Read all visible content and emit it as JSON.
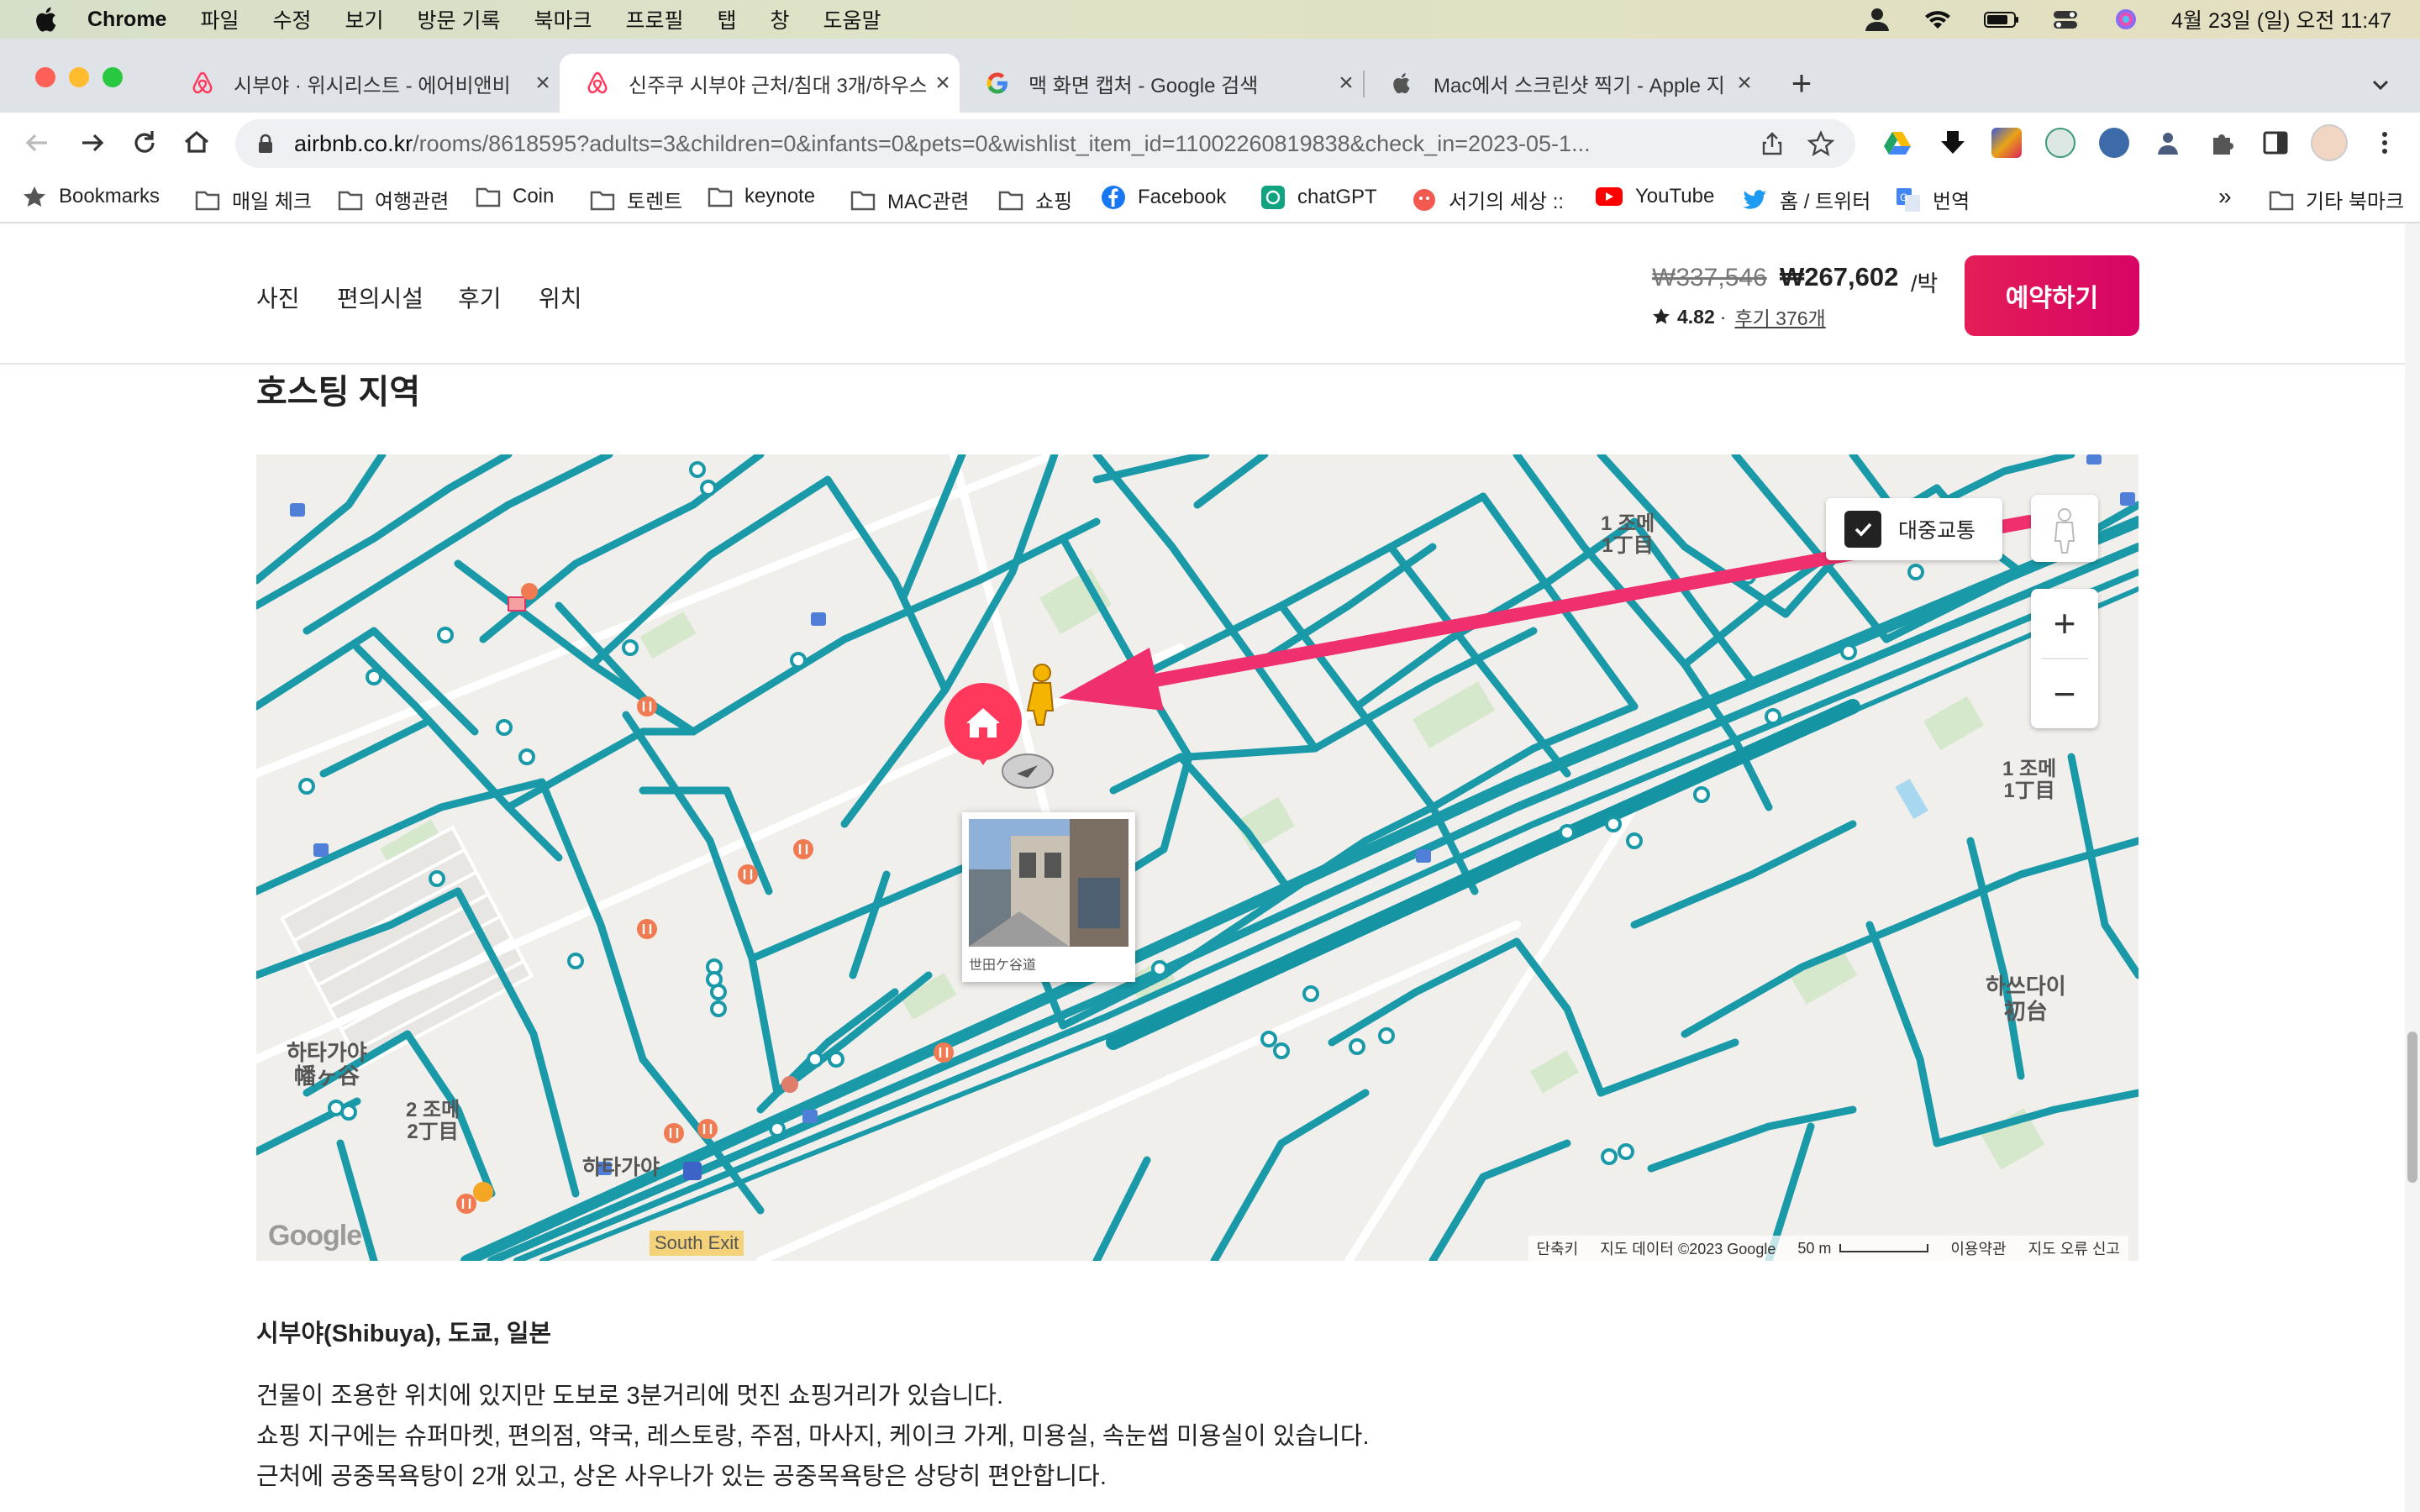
{
  "menubar": {
    "app_name": "Chrome",
    "items": [
      "파일",
      "수정",
      "보기",
      "방문 기록",
      "북마크",
      "프로필",
      "탭",
      "창",
      "도움말"
    ],
    "datetime": "4월 23일 (일) 오전 11:47"
  },
  "tabs": [
    {
      "label": "시부야 · 위시리스트 - 에어비앤비",
      "icon": "airbnb-icon"
    },
    {
      "label": "신주쿠 시부야 근처/침대 3개/하우스",
      "icon": "airbnb-icon",
      "active": true
    },
    {
      "label": "맥 화면 캡처 - Google 검색",
      "icon": "google-icon"
    },
    {
      "label": "Mac에서 스크린샷 찍기 - Apple 지",
      "icon": "apple-icon"
    }
  ],
  "address": {
    "host": "airbnb.co.kr",
    "path": "/rooms/8618595?adults=3&children=0&infants=0&pets=0&wishlist_item_id=11002260819838&check_in=2023-05-1..."
  },
  "bookmarks": {
    "items": [
      {
        "label": "Bookmarks",
        "icon": "star-icon"
      },
      {
        "label": "매일 체크",
        "icon": "folder-icon"
      },
      {
        "label": "여행관련",
        "icon": "folder-icon"
      },
      {
        "label": "Coin",
        "icon": "folder-icon"
      },
      {
        "label": "토렌트",
        "icon": "folder-icon"
      },
      {
        "label": "keynote",
        "icon": "folder-icon"
      },
      {
        "label": "MAC관련",
        "icon": "folder-icon"
      },
      {
        "label": "쇼핑",
        "icon": "folder-icon"
      },
      {
        "label": "Facebook",
        "icon": "facebook-icon"
      },
      {
        "label": "chatGPT",
        "icon": "chatgpt-icon"
      },
      {
        "label": "서기의 세상 ::",
        "icon": "site-icon"
      },
      {
        "label": "YouTube",
        "icon": "youtube-icon"
      },
      {
        "label": "홈 / 트위터",
        "icon": "twitter-icon"
      },
      {
        "label": "번역",
        "icon": "translate-icon"
      }
    ],
    "overflow": "»",
    "other": "기타 북마크"
  },
  "subnav": {
    "links": [
      "사진",
      "편의시설",
      "후기",
      "위치"
    ]
  },
  "booking": {
    "price_old": "₩337,546",
    "price_new": "₩267,602",
    "price_unit": "/박",
    "rating": "4.82",
    "separator": "·",
    "reviews": "후기 376개",
    "reserve_label": "예약하기"
  },
  "section_title": "호스팅 지역",
  "map": {
    "transit_label": "대중교통",
    "zoom_in": "+",
    "zoom_out": "−",
    "labels": {
      "chome1_top": "1 조메\n1丁目",
      "chome1_right": "1 조메\n1丁目",
      "hatsudai": "하쓰다이\n初台",
      "hatagaya_left": "하타가야\n幡ヶ谷",
      "chome2": "2 조메\n2丁目",
      "hatagaya_station": "하타가야"
    },
    "streetview_caption": "世田ケ谷道",
    "exit_label": "South Exit",
    "google": "Google",
    "footer": {
      "shortcuts": "단축키",
      "data": "지도 데이터 ©2023 Google",
      "scale": "50 m",
      "terms": "이용약관",
      "report": "지도 오류 신고"
    }
  },
  "location": {
    "title": "시부야(Shibuya), 도쿄, 일본",
    "lines": [
      "건물이 조용한 위치에 있지만 도보로 3분거리에 멋진 쇼핑거리가 있습니다.",
      "쇼핑 지구에는 슈퍼마켓, 편의점, 약국, 레스토랑, 주점, 마사지, 케이크 가게, 미용실, 속눈썹 미용실이 있습니다.",
      "근처에 공중목욕탕이 2개 있고, 상온 사우나가 있는 공중목욕탕은 상당히 편안합니다."
    ]
  },
  "colors": {
    "accent": "#e41d57",
    "route": "#1a9aa8",
    "arrow": "#f0306e"
  }
}
